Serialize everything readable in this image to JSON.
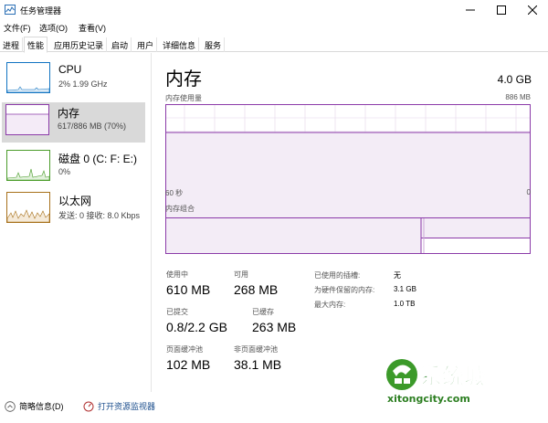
{
  "window": {
    "title": "任务管理器",
    "controls": {
      "minimize": "—",
      "maximize": "☐",
      "close": "✕"
    }
  },
  "menu": [
    "文件(F)",
    "选项(O)",
    "查看(V)"
  ],
  "tabs": [
    {
      "label": "进程",
      "active": false
    },
    {
      "label": "性能",
      "active": true
    },
    {
      "label": "应用历史记录",
      "active": false
    },
    {
      "label": "启动",
      "active": false
    },
    {
      "label": "用户",
      "active": false
    },
    {
      "label": "详细信息",
      "active": false
    },
    {
      "label": "服务",
      "active": false
    }
  ],
  "sidebar": {
    "items": [
      {
        "name": "CPU",
        "sub": "2% 1.99 GHz",
        "color": "#1174c2",
        "selected": false
      },
      {
        "name": "内存",
        "sub": "617/886 MB (70%)",
        "color": "#8b3aa8",
        "selected": true
      },
      {
        "name": "磁盘 0 (C: F: E:)",
        "sub": "0%",
        "color": "#4a9c2a",
        "selected": false
      },
      {
        "name": "以太网",
        "sub": "发送: 0  接收: 8.0 Kbps",
        "color": "#a7701a",
        "selected": false
      }
    ]
  },
  "main": {
    "title": "内存",
    "total": "4.0 GB",
    "usage_label": "内存使用量",
    "usage_max": "886 MB",
    "time_left": "60 秒",
    "time_right": "0",
    "composition_label": "内存组合",
    "composition_in_use_fraction": 0.7,
    "stats": {
      "in_use_label": "使用中",
      "in_use_value": "610 MB",
      "available_label": "可用",
      "available_value": "268 MB",
      "committed_label": "已提交",
      "committed_value": "0.8/2.2 GB",
      "cached_label": "已缓存",
      "cached_value": "263 MB",
      "paged_label": "页面缓冲池",
      "paged_value": "102 MB",
      "nonpaged_label": "非页面缓冲池",
      "nonpaged_value": "38.1 MB"
    },
    "kv": [
      {
        "label": "已使用的插槽:",
        "value": "无"
      },
      {
        "label": "为硬件保留的内存:",
        "value": "3.1 GB"
      },
      {
        "label": "最大内存:",
        "value": "1.0 TB"
      }
    ]
  },
  "footer": {
    "less_details": "简略信息(D)",
    "open_monitor": "打开资源监视器"
  },
  "watermark": {
    "text": "系统城",
    "url": "xitongcity.com"
  },
  "colors": {
    "memory": "#8b3aa8",
    "cpu": "#1174c2",
    "disk": "#4a9c2a",
    "ethernet": "#a7701a",
    "selected_bg": "#d9d9d9"
  }
}
